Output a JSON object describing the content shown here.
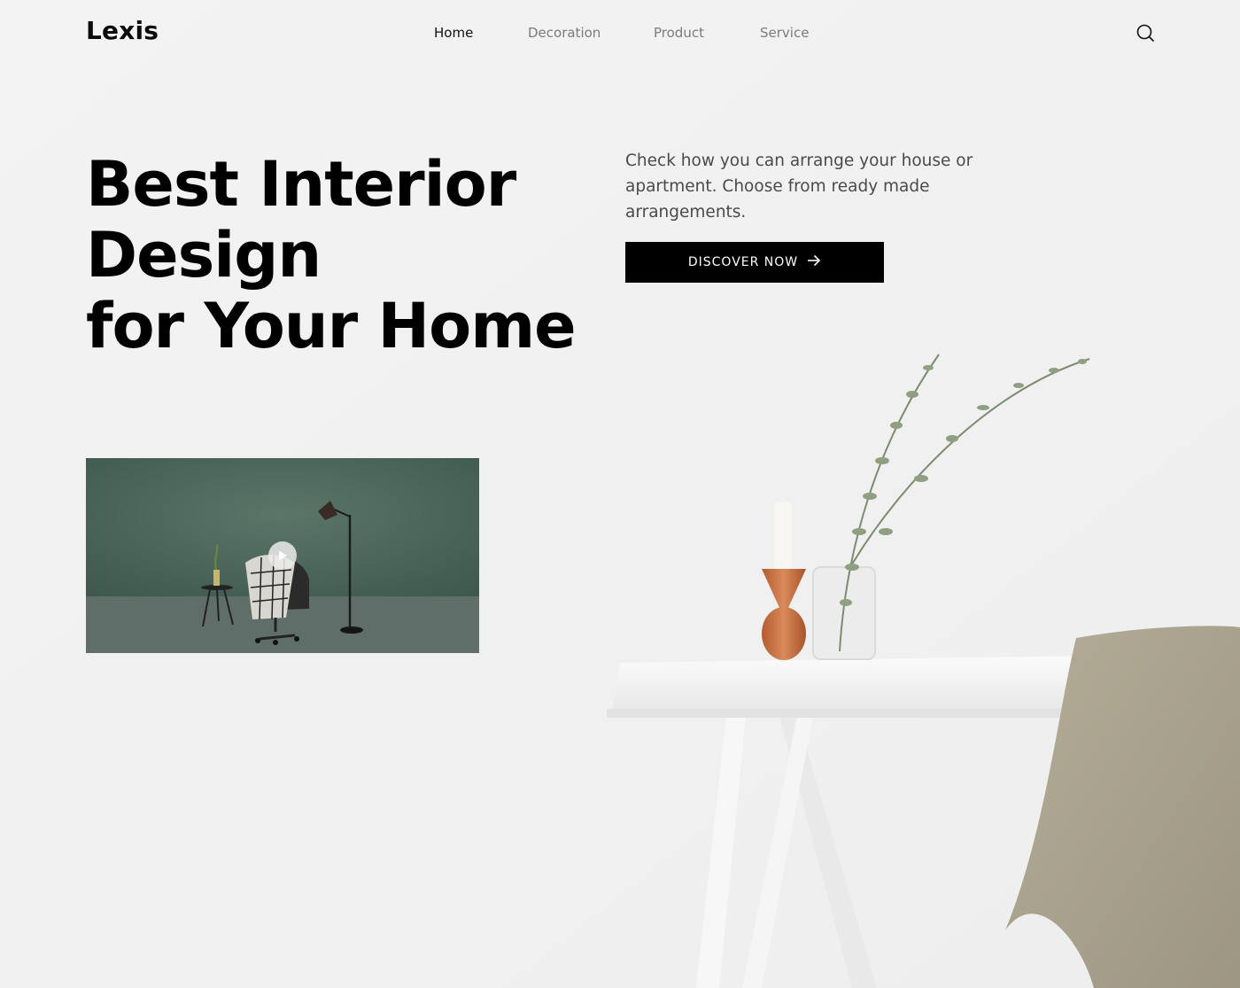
{
  "header": {
    "logo": "Lexis",
    "nav": [
      {
        "label": "Home",
        "active": true
      },
      {
        "label": "Decoration",
        "active": false
      },
      {
        "label": "Product",
        "active": false
      },
      {
        "label": "Service",
        "active": false
      }
    ],
    "search_icon": "search-icon"
  },
  "hero": {
    "title_lines": [
      "Best Interior",
      "Design",
      "for Your Home"
    ],
    "description": "Check how you can arrange your house or apartment. Choose from ready made arrangements.",
    "cta_label": "DISCOVER NOW",
    "cta_icon": "arrow-right-icon"
  },
  "video": {
    "play_icon": "play-icon"
  },
  "colors": {
    "background": "#f1f1f1",
    "accent": "#000000",
    "text_muted": "#7b7b7b",
    "video_wall": "#4f6a60"
  }
}
